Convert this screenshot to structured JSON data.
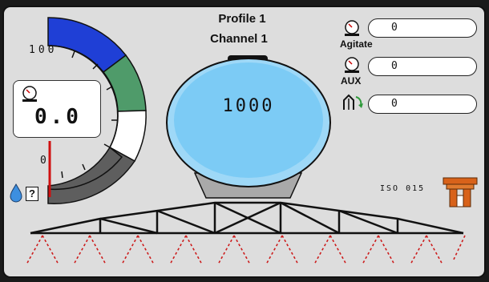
{
  "header": {
    "profile": "Profile 1",
    "channel": "Channel 1"
  },
  "gauge": {
    "scale_max": "100",
    "scale_min": "0",
    "value": "0.0",
    "level": 0.0
  },
  "tank": {
    "volume": "1000"
  },
  "indicators": [
    {
      "label": "Agitate",
      "value": "0",
      "icon": "pressure-gauge-icon"
    },
    {
      "label": "AUX",
      "value": "0",
      "icon": "pressure-gauge-icon"
    },
    {
      "label": "",
      "value": "0",
      "icon": "flow-valve-icon"
    }
  ],
  "nozzle": {
    "label": "ISO 015",
    "color": "#d8621a"
  },
  "status": {
    "unknown": "?"
  },
  "colors": {
    "blue": "#1f3fd6",
    "green": "#4f9b6a",
    "dark": "#5e5e5e",
    "tank": "#7ccbf5",
    "needle": "#d01010"
  }
}
